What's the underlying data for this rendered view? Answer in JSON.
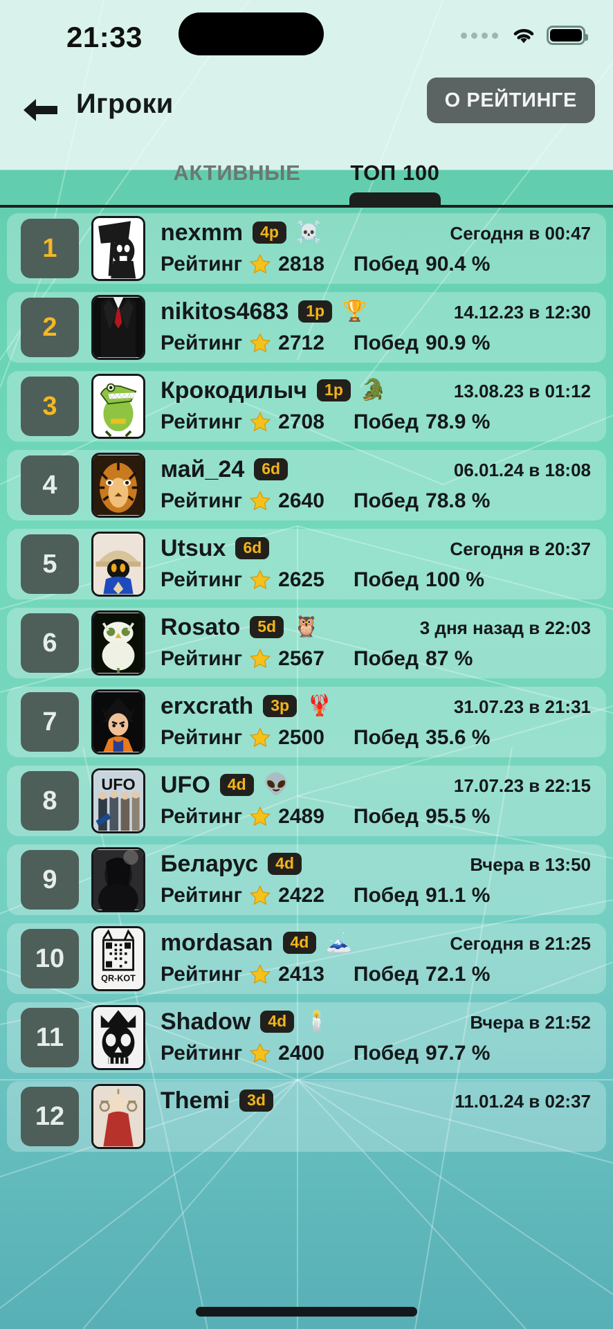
{
  "status_bar": {
    "time": "21:33",
    "icons": [
      "cellular-dots-icon",
      "wifi-icon",
      "battery-icon"
    ]
  },
  "nav": {
    "back_icon": "arrow-left-icon",
    "title": "Игроки",
    "about_button": "О РЕЙТИНГЕ"
  },
  "tabs": [
    {
      "label": "АКТИВНЫЕ",
      "active": false
    },
    {
      "label": "ТОП 100",
      "active": true
    }
  ],
  "labels": {
    "rating": "Рейтинг",
    "wins": "Побед",
    "star_icon": "star-icon"
  },
  "colors": {
    "accent_gold": "#f2b41c",
    "rank_chip": "#4e5f59",
    "row_bg": "rgba(255,255,255,0.26)",
    "button_bg": "#5c6463",
    "text": "#14181a"
  },
  "players": [
    {
      "rank": "1",
      "name": "nexmm",
      "badge": "4p",
      "emoji": "☠️",
      "rating": "2818",
      "wins": "90.4 %",
      "time": "Сегодня в 00:47",
      "avatar": "reaper-flag-avatar"
    },
    {
      "rank": "2",
      "name": "nikitos4683",
      "badge": "1p",
      "emoji": "🏆",
      "rating": "2712",
      "wins": "90.9 %",
      "time": "14.12.23 в 12:30",
      "avatar": "suit-tie-avatar"
    },
    {
      "rank": "3",
      "name": "Крокодилыч",
      "badge": "1p",
      "emoji": "🐊",
      "rating": "2708",
      "wins": "78.9 %",
      "time": "13.08.23 в 01:12",
      "avatar": "cartoon-crocodile-avatar"
    },
    {
      "rank": "4",
      "name": "май_24",
      "badge": "6d",
      "emoji": "",
      "rating": "2640",
      "wins": "78.8 %",
      "time": "06.01.24 в 18:08",
      "avatar": "tiger-face-avatar"
    },
    {
      "rank": "5",
      "name": "Utsux",
      "badge": "6d",
      "emoji": "",
      "rating": "2625",
      "wins": "100 %",
      "time": "Сегодня в 20:37",
      "avatar": "black-mage-avatar"
    },
    {
      "rank": "6",
      "name": "Rosato",
      "badge": "5d",
      "emoji": "🦉",
      "rating": "2567",
      "wins": "87 %",
      "time": "3 дня назад в 22:03",
      "avatar": "white-owl-avatar"
    },
    {
      "rank": "7",
      "name": "erxcrath",
      "badge": "3p",
      "emoji": "🦞",
      "rating": "2500",
      "wins": "35.6 %",
      "time": "31.07.23 в 21:31",
      "avatar": "anime-character-avatar"
    },
    {
      "rank": "8",
      "name": "UFO",
      "badge": "4d",
      "emoji": "👽",
      "rating": "2489",
      "wins": "95.5 %",
      "time": "17.07.23 в 22:15",
      "avatar": "ufo-band-avatar"
    },
    {
      "rank": "9",
      "name": "Беларус",
      "badge": "4d",
      "emoji": "",
      "rating": "2422",
      "wins": "91.1 %",
      "time": "Вчера в 13:50",
      "avatar": "dark-portrait-avatar"
    },
    {
      "rank": "10",
      "name": "mordasan",
      "badge": "4d",
      "emoji": "🗻",
      "rating": "2413",
      "wins": "72.1 %",
      "time": "Сегодня в 21:25",
      "avatar": "qr-cat-avatar"
    },
    {
      "rank": "11",
      "name": "Shadow",
      "badge": "4d",
      "emoji": "🕯️",
      "rating": "2400",
      "wins": "97.7 %",
      "time": "Вчера в 21:52",
      "avatar": "crowned-skull-avatar"
    },
    {
      "rank": "12",
      "name": "Themi",
      "badge": "3d",
      "emoji": "",
      "rating": "",
      "wins": "",
      "time": "11.01.24 в 02:37",
      "avatar": "themis-statue-avatar"
    }
  ]
}
